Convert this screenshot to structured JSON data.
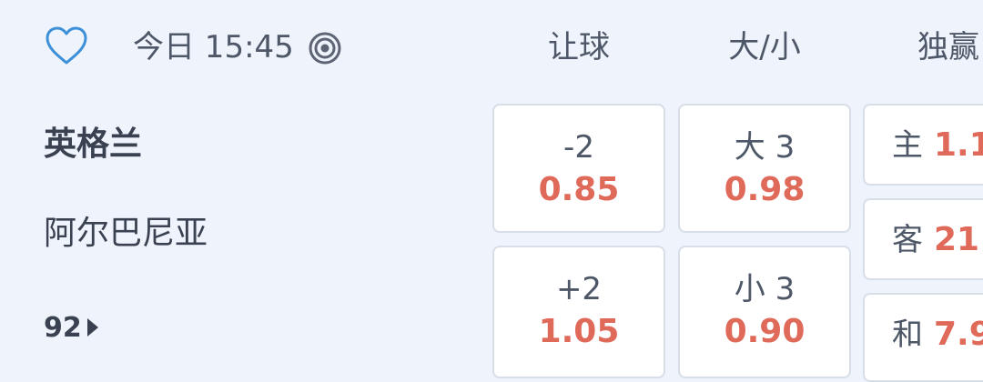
{
  "header": {
    "match_time": "今日 15:45",
    "columns": {
      "handicap": "让球",
      "over_under": "大/小",
      "moneyline": "独赢"
    },
    "icons": {
      "favorite": "heart-outline-icon",
      "live": "target-icon"
    }
  },
  "teams": {
    "home": "英格兰",
    "away": "阿尔巴尼亚"
  },
  "more_markets": {
    "count": "92"
  },
  "handicap": {
    "home": {
      "line": "-2",
      "price": "0.85"
    },
    "away": {
      "line": "+2",
      "price": "1.05"
    }
  },
  "over_under": {
    "over": {
      "line": "大 3",
      "price": "0.98"
    },
    "under": {
      "line": "小 3",
      "price": "0.90"
    }
  },
  "moneyline": {
    "home": {
      "label": "主",
      "price": "1.1"
    },
    "away": {
      "label": "客",
      "price": "21"
    },
    "draw": {
      "label": "和",
      "price": "7.9"
    }
  },
  "colors": {
    "background": "#eef3fc",
    "accent": "#3d8fd8",
    "price": "#e06a5a",
    "text": "#4e5767",
    "box_border": "#d8dee8"
  }
}
